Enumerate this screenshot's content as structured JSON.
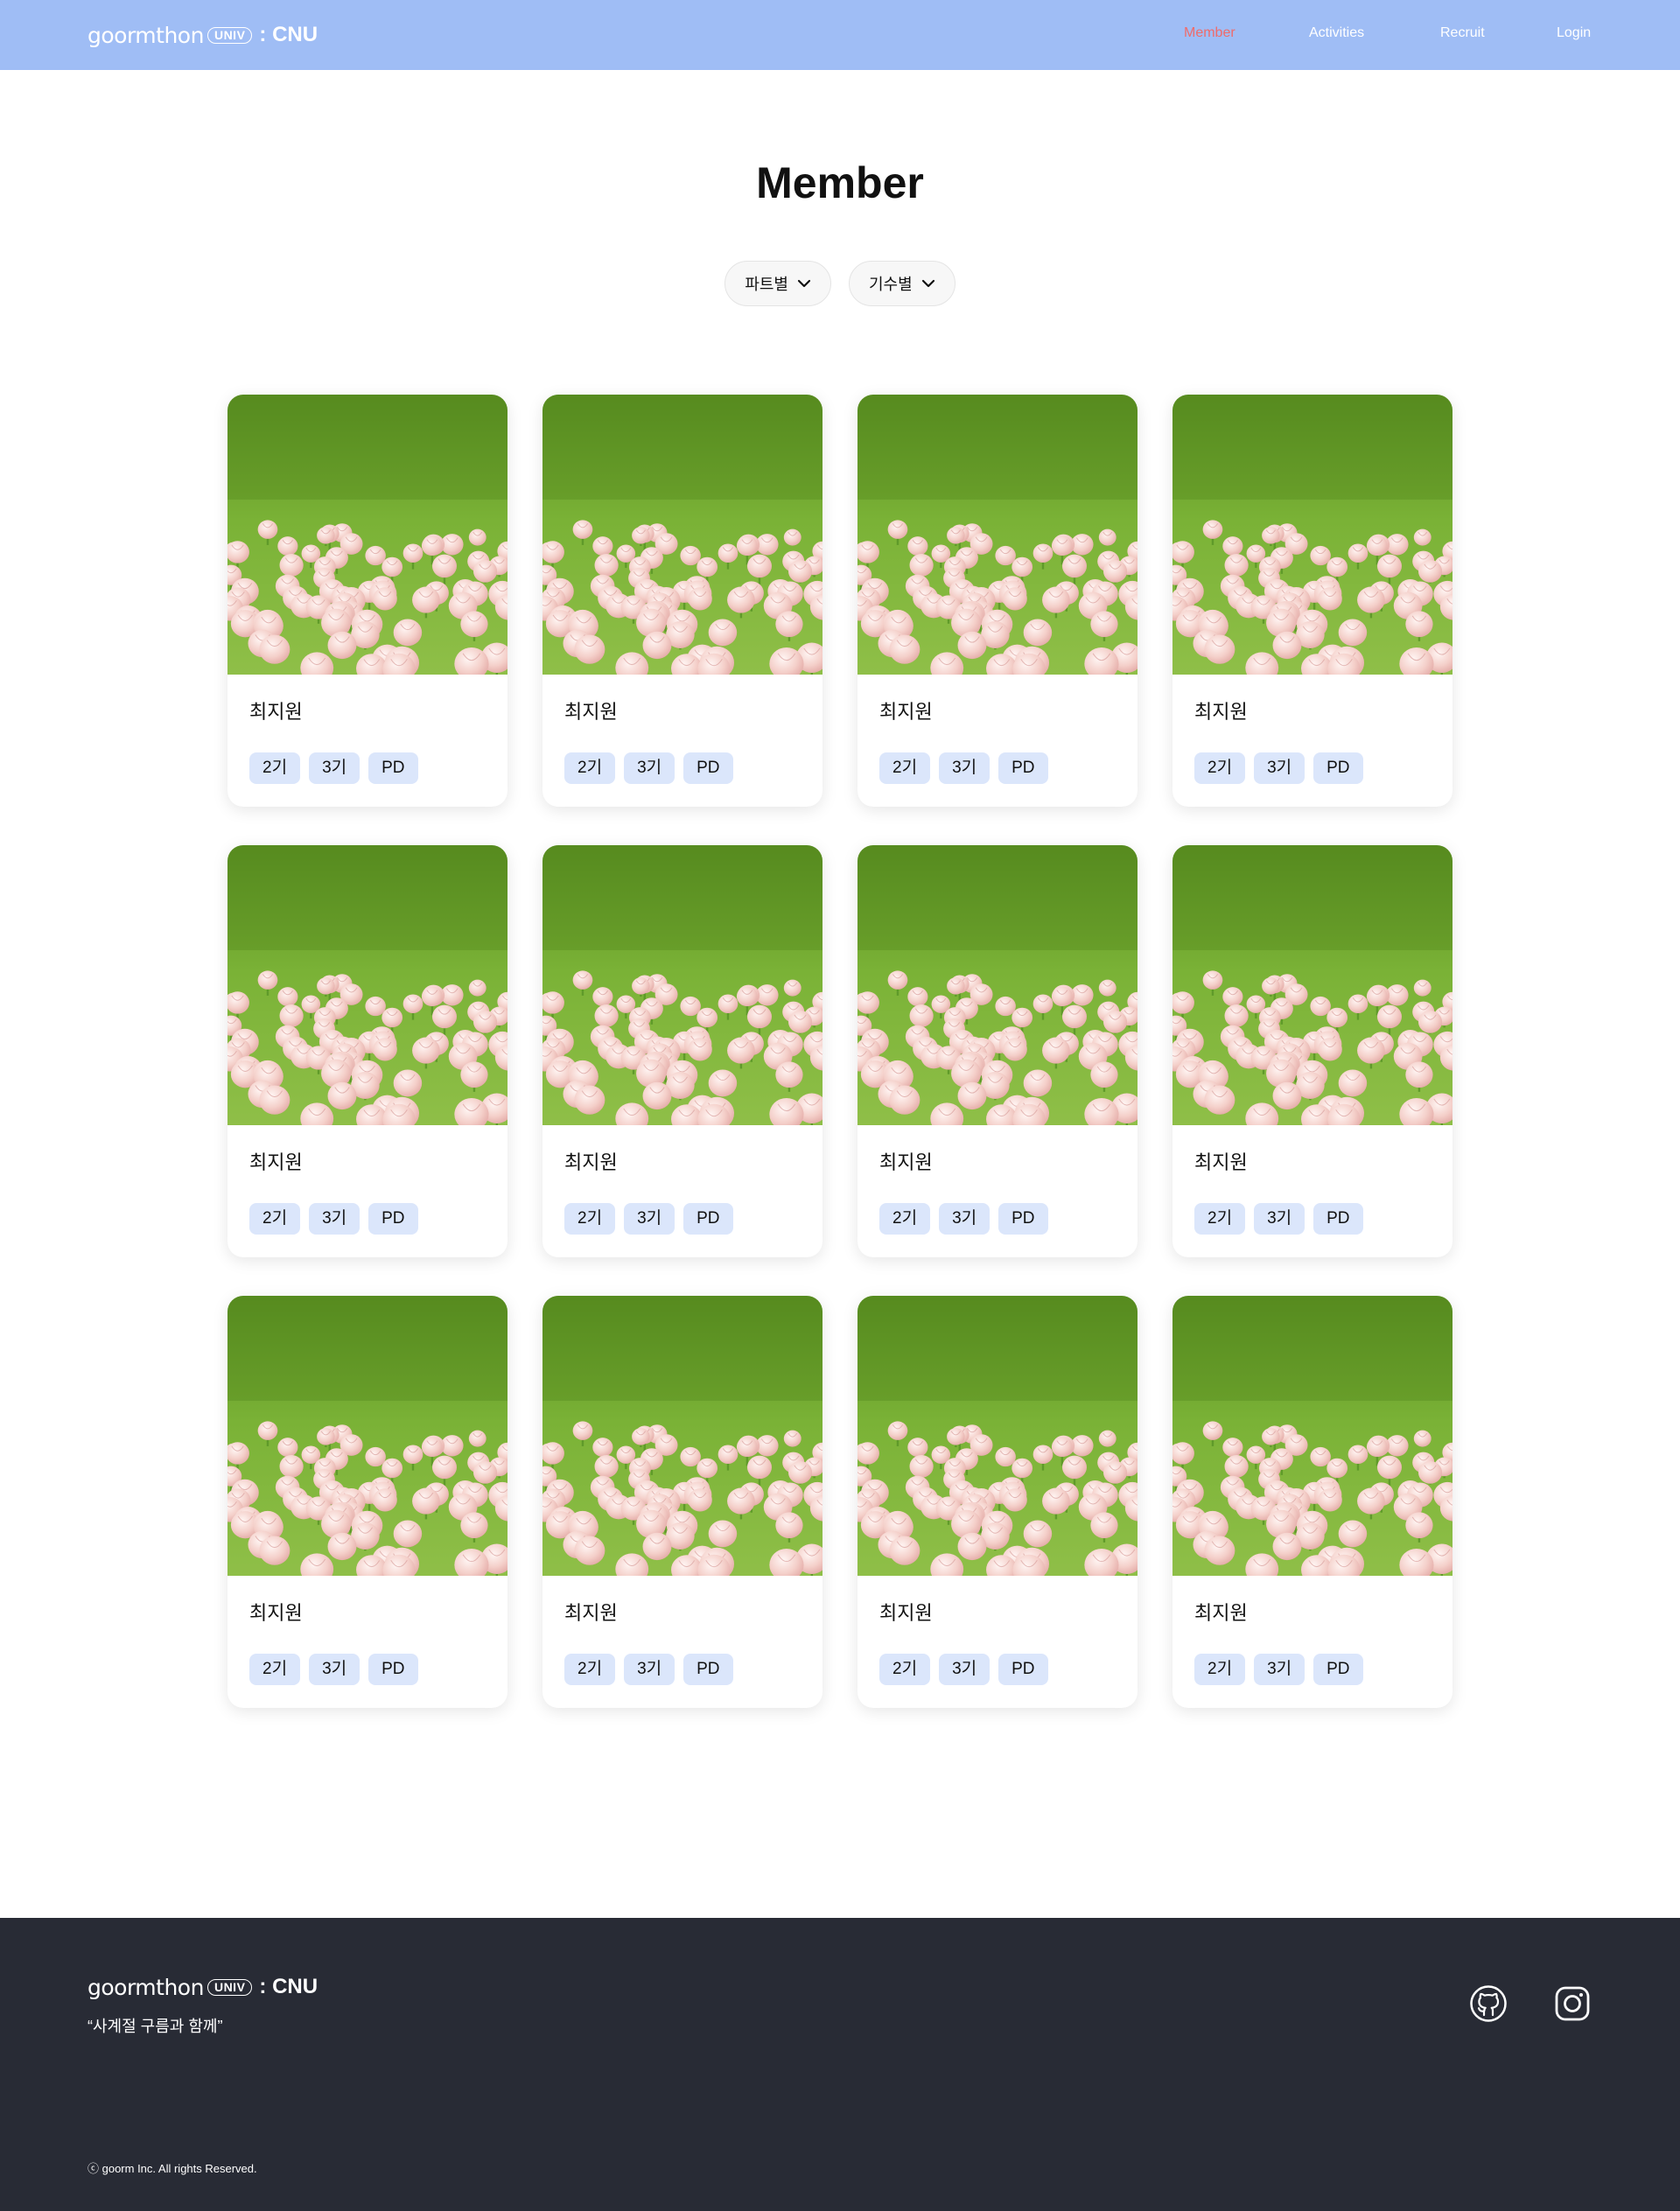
{
  "brand": {
    "word": "goormthon",
    "pill": "UNIV",
    "suffix": ": CNU"
  },
  "nav": {
    "items": [
      {
        "label": "Member",
        "active": true
      },
      {
        "label": "Activities",
        "active": false
      },
      {
        "label": "Recruit",
        "active": false
      },
      {
        "label": "Login",
        "active": false
      }
    ]
  },
  "colors": {
    "header_bg": "#9fbdf5",
    "nav_active": "#ef6b6b",
    "tag_bg": "#dbe6fb",
    "footer_bg": "#282b35"
  },
  "main": {
    "title": "Member",
    "filters": [
      {
        "label": "파트별",
        "icon": "chevron-down-icon"
      },
      {
        "label": "기수별",
        "icon": "chevron-down-icon"
      }
    ]
  },
  "members": [
    {
      "name": "최지원",
      "tags": [
        "2기",
        "3기",
        "PD"
      ]
    },
    {
      "name": "최지원",
      "tags": [
        "2기",
        "3기",
        "PD"
      ]
    },
    {
      "name": "최지원",
      "tags": [
        "2기",
        "3기",
        "PD"
      ]
    },
    {
      "name": "최지원",
      "tags": [
        "2기",
        "3기",
        "PD"
      ]
    },
    {
      "name": "최지원",
      "tags": [
        "2기",
        "3기",
        "PD"
      ]
    },
    {
      "name": "최지원",
      "tags": [
        "2기",
        "3기",
        "PD"
      ]
    },
    {
      "name": "최지원",
      "tags": [
        "2기",
        "3기",
        "PD"
      ]
    },
    {
      "name": "최지원",
      "tags": [
        "2기",
        "3기",
        "PD"
      ]
    },
    {
      "name": "최지원",
      "tags": [
        "2기",
        "3기",
        "PD"
      ]
    },
    {
      "name": "최지원",
      "tags": [
        "2기",
        "3기",
        "PD"
      ]
    },
    {
      "name": "최지원",
      "tags": [
        "2기",
        "3기",
        "PD"
      ]
    },
    {
      "name": "최지원",
      "tags": [
        "2기",
        "3기",
        "PD"
      ]
    }
  ],
  "footer": {
    "tagline": "“사계절 구름과 함께”",
    "copyright": "ⓒ goorm Inc. All rights Reserved.",
    "social": [
      {
        "icon": "github-icon"
      },
      {
        "icon": "instagram-icon"
      }
    ]
  }
}
